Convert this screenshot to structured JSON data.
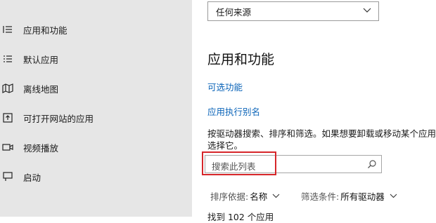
{
  "sidebar": {
    "items": [
      {
        "label": "应用和功能",
        "icon": "list-icon"
      },
      {
        "label": "默认应用",
        "icon": "default-apps-icon"
      },
      {
        "label": "离线地图",
        "icon": "map-icon"
      },
      {
        "label": "可打开网站的应用",
        "icon": "web-apps-icon"
      },
      {
        "label": "视频播放",
        "icon": "video-icon"
      },
      {
        "label": "启动",
        "icon": "startup-icon"
      }
    ]
  },
  "main": {
    "source_dropdown": {
      "value": "任何来源"
    },
    "heading": "应用和功能",
    "links": {
      "optional_features": "可选功能",
      "app_execution_alias": "应用执行别名"
    },
    "description_line1": "按驱动器搜索、排序和筛选。如果想要卸载或移动某个应用，",
    "description_line2": "选择它。",
    "search": {
      "placeholder": "搜索此列表"
    },
    "sort": {
      "key": "排序依据:",
      "value": "名称"
    },
    "filter": {
      "key": "筛选条件:",
      "value": "所有驱动器"
    },
    "app_count": "找到 102 个应用"
  },
  "colors": {
    "sidebar_bg": "#e6e6e6",
    "link": "#0a63b8",
    "highlight": "#d6262a"
  }
}
